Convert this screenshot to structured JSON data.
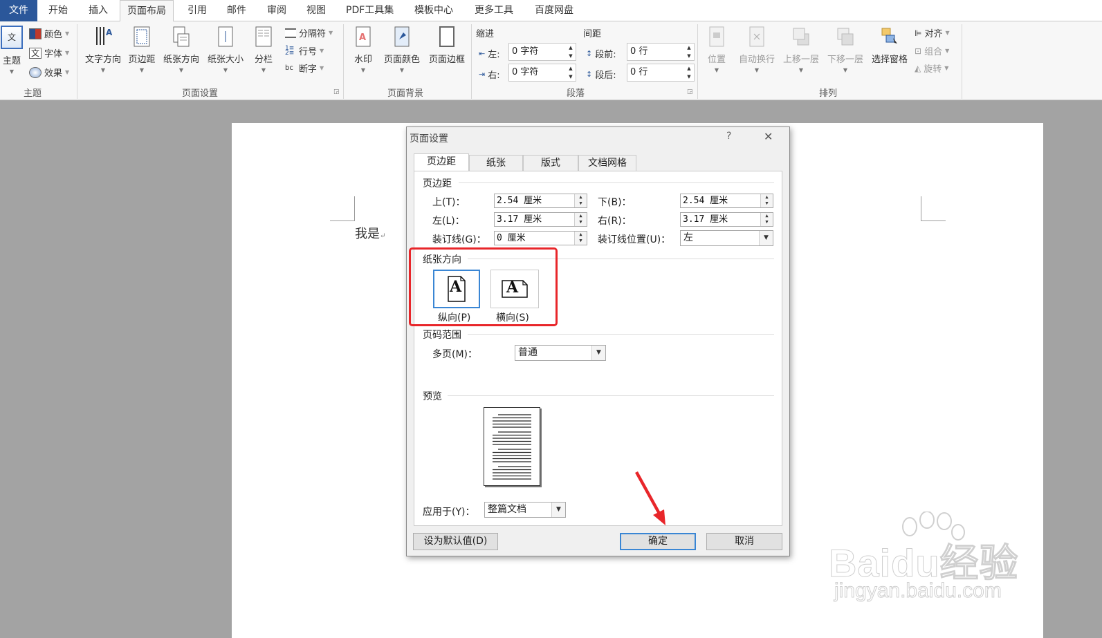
{
  "menu": {
    "tabs": [
      "文件",
      "开始",
      "插入",
      "页面布局",
      "引用",
      "邮件",
      "审阅",
      "视图",
      "PDF工具集",
      "模板中心",
      "更多工具",
      "百度网盘"
    ]
  },
  "ribbon": {
    "theme": {
      "big": "主题",
      "color": "颜色",
      "font": "字体",
      "effect": "效果",
      "group": "主题"
    },
    "page_setup": {
      "text_direction": "文字方向",
      "margins": "页边距",
      "orientation": "纸张方向",
      "size": "纸张大小",
      "columns": "分栏",
      "breaks": "分隔符",
      "line_numbers": "行号",
      "hyphenation": "断字",
      "group": "页面设置"
    },
    "page_background": {
      "watermark": "水印",
      "page_color": "页面颜色",
      "page_borders": "页面边框",
      "group": "页面背景"
    },
    "paragraph": {
      "indent": "缩进",
      "spacing": "间距",
      "left_label": "左:",
      "left_value": "0 字符",
      "right_label": "右:",
      "right_value": "0 字符",
      "before_label": "段前:",
      "before_value": "0 行",
      "after_label": "段后:",
      "after_value": "0 行",
      "group": "段落"
    },
    "arrange": {
      "position": "位置",
      "wrap_text": "自动换行",
      "bring_forward": "上移一层",
      "send_backward": "下移一层",
      "selection_pane": "选择窗格",
      "align": "对齐",
      "group_btn": "组合",
      "rotate": "旋转",
      "group": "排列"
    }
  },
  "document": {
    "text": "我是"
  },
  "dialog": {
    "title": "页面设置",
    "help": "?",
    "close": "✕",
    "tabs": [
      "页边距",
      "纸张",
      "版式",
      "文档网格"
    ],
    "margins": {
      "section": "页边距",
      "top_label": "上(T)：",
      "top_value": "2.54 厘米",
      "bottom_label": "下(B)：",
      "bottom_value": "2.54 厘米",
      "left_label": "左(L)：",
      "left_value": "3.17 厘米",
      "right_label": "右(R)：",
      "right_value": "3.17 厘米",
      "gutter_label": "装订线(G)：",
      "gutter_value": "0 厘米",
      "gutter_pos_label": "装订线位置(U)：",
      "gutter_pos_value": "左"
    },
    "orientation": {
      "section": "纸张方向",
      "portrait": "纵向(P)",
      "landscape": "横向(S)",
      "icon_letter": "A"
    },
    "pages": {
      "section": "页码范围",
      "multiple_label": "多页(M)：",
      "multiple_value": "普通"
    },
    "preview": {
      "section": "预览"
    },
    "apply": {
      "label": "应用于(Y)：",
      "value": "整篇文档"
    },
    "buttons": {
      "default": "设为默认值(D)",
      "ok": "确定",
      "cancel": "取消"
    }
  },
  "watermark": {
    "brand": "Baidu经验",
    "url": "jingyan.baidu.com"
  },
  "colors": {
    "accent": "#2b579a",
    "highlight": "#e8262a",
    "annot_arrow": "#e8262a"
  }
}
